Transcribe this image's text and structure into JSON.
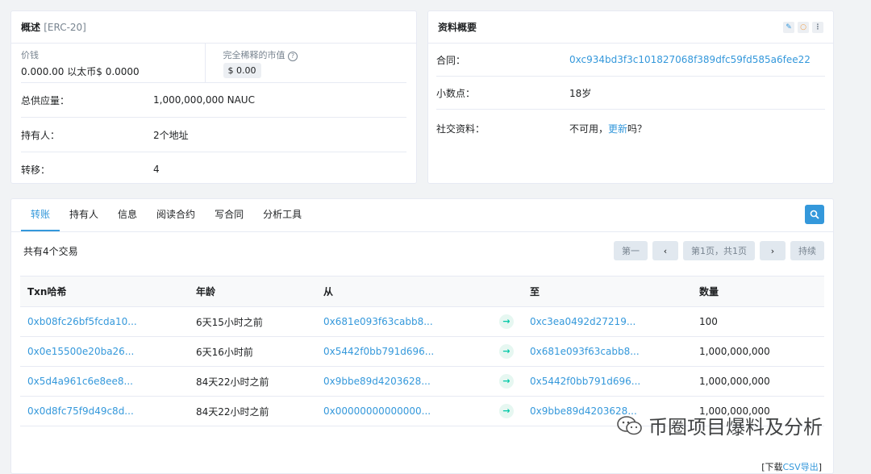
{
  "overview": {
    "title": "概述",
    "tag": "[ERC-20]",
    "price_label": "价钱",
    "price_value": "0.000.00 以太币$ 0.0000",
    "mcap_label": "完全稀释的市值",
    "mcap_value": "$ 0.00",
    "rows": [
      {
        "k": "总供应量：",
        "v": "1,000,000,000 NAUC"
      },
      {
        "k": "持有人：",
        "v": "2个地址"
      },
      {
        "k": "转移：",
        "v": "4"
      }
    ]
  },
  "profile": {
    "title": "资料概要",
    "contract_label": "合同：",
    "contract_value": "0xc934bd3f3c101827068f389dfc59fd585a6fee22",
    "decimals_label": "小数点：",
    "decimals_value": "18岁",
    "social_label": "社交资料：",
    "social_pre": "不可用，",
    "social_link": "更新",
    "social_post": "吗？"
  },
  "tabs": [
    "转账",
    "持有人",
    "信息",
    "阅读合约",
    "写合同",
    "分析工具"
  ],
  "toolbar": {
    "count_text": "共有4个交易",
    "first": "第一",
    "page_info": "第1页，共1页",
    "last": "持续"
  },
  "table": {
    "headers": [
      "Txn哈希",
      "年龄",
      "从",
      "",
      "至",
      "数量"
    ],
    "rows": [
      {
        "hash": "0xb08fc26bf5fcda10...",
        "age": "6天15小时之前",
        "from": "0x681e093f63cabb8...",
        "to": "0xc3ea0492d27219...",
        "qty": "100"
      },
      {
        "hash": "0x0e15500e20ba26...",
        "age": "6天16小时前",
        "from": "0x5442f0bb791d696...",
        "to": "0x681e093f63cabb8...",
        "qty": "1,000,000,000"
      },
      {
        "hash": "0x5d4a961c6e8ee8...",
        "age": "84天22小时之前",
        "from": "0x9bbe89d4203628...",
        "to": "0x5442f0bb791d696...",
        "qty": "1,000,000,000"
      },
      {
        "hash": "0x0d8fc75f9d49c8d...",
        "age": "84天22小时之前",
        "from": "0x00000000000000...",
        "to": "0x9bbe89d4203628...",
        "qty": "1,000,000,000"
      }
    ]
  },
  "footer": {
    "pre": "[下载",
    "link": "CSV导出",
    "post": "]"
  },
  "watermark": "币圈项目爆料及分析"
}
